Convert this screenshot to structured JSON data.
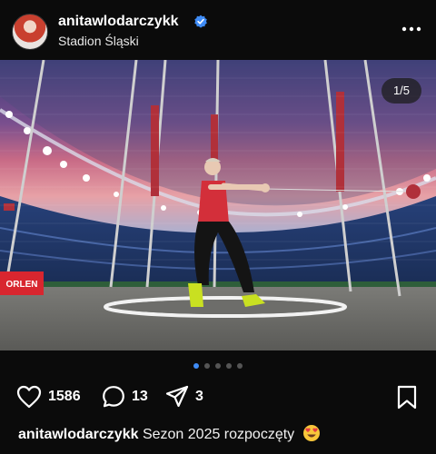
{
  "post": {
    "username": "anitawlodarczykk",
    "location": "Stadion Śląski",
    "verified": true,
    "photo_counter": "1/5",
    "carousel": {
      "total": 5,
      "active": 0
    },
    "likes": "1586",
    "comments": "13",
    "shares": "3",
    "caption_user": "anitawlodarczykk",
    "caption_text": "Sezon 2025 rozpoczęty",
    "caption_emoji": "heart-eyes-emoji",
    "banner_text": "ORLEN"
  },
  "icons": {
    "verified": "verified-badge-icon",
    "more": "more-options-icon",
    "like": "heart-icon",
    "comment": "comment-icon",
    "share": "share-icon",
    "save": "bookmark-icon"
  },
  "colors": {
    "background": "#0b0b0b",
    "verified_blue": "#3f8cf6",
    "active_dot": "#3f8cf6"
  }
}
